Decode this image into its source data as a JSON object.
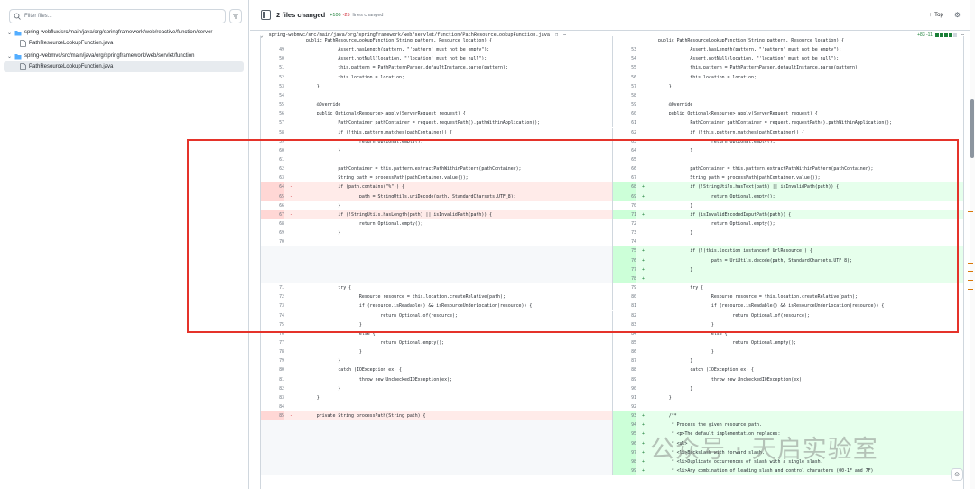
{
  "sidebar": {
    "filter_placeholder": "Filter files...",
    "tree": [
      {
        "type": "folder",
        "label": "spring-webflux/src/main/java/org/springframework/web/reactive/function/server"
      },
      {
        "type": "file",
        "label": "PathResourceLookupFunction.java"
      },
      {
        "type": "folder",
        "label": "spring-webmvc/src/main/java/org/springframework/web/servlet/function"
      },
      {
        "type": "file",
        "label": "PathResourceLookupFunction.java",
        "selected": true
      }
    ]
  },
  "topbar": {
    "files_changed": "2 files changed",
    "additions": "+106",
    "deletions": "-25",
    "files_changed_suffix": "lines changed",
    "top_label": "Top"
  },
  "file_header": {
    "path": "spring-webmvc/src/main/java/org/springframework/web/servlet/function/PathResourceLookupFunction.java",
    "stat": "+83 -11"
  },
  "watermark": "公众号 · 天启实验室",
  "diff_rows": [
    {
      "t": "hunk",
      "l": {
        "n": "",
        "c": "public PathResourceLookupFunction(String pattern, Resource location) {"
      },
      "r": {
        "n": "",
        "c": "public PathResourceLookupFunction(String pattern, Resource location) {"
      }
    },
    {
      "l": {
        "n": "49",
        "c": "            Assert.hasLength(pattern, \"'pattern' must not be empty\");"
      },
      "r": {
        "n": "53",
        "c": "            Assert.hasLength(pattern, \"'pattern' must not be empty\");"
      }
    },
    {
      "l": {
        "n": "50",
        "c": "            Assert.notNull(location, \"'location' must not be null\");"
      },
      "r": {
        "n": "54",
        "c": "            Assert.notNull(location, \"'location' must not be null\");"
      }
    },
    {
      "l": {
        "n": "51",
        "c": "            this.pattern = PathPatternParser.defaultInstance.parse(pattern);"
      },
      "r": {
        "n": "55",
        "c": "            this.pattern = PathPatternParser.defaultInstance.parse(pattern);"
      }
    },
    {
      "l": {
        "n": "52",
        "c": "            this.location = location;"
      },
      "r": {
        "n": "56",
        "c": "            this.location = location;"
      }
    },
    {
      "l": {
        "n": "53",
        "c": "    }"
      },
      "r": {
        "n": "57",
        "c": "    }"
      }
    },
    {
      "l": {
        "n": "54",
        "c": ""
      },
      "r": {
        "n": "58",
        "c": ""
      }
    },
    {
      "l": {
        "n": "55",
        "c": "    @Override"
      },
      "r": {
        "n": "59",
        "c": "    @Override"
      }
    },
    {
      "l": {
        "n": "56",
        "c": "    public Optional<Resource> apply(ServerRequest request) {"
      },
      "r": {
        "n": "60",
        "c": "    public Optional<Resource> apply(ServerRequest request) {"
      }
    },
    {
      "l": {
        "n": "57",
        "c": "            PathContainer pathContainer = request.requestPath().pathWithinApplication();"
      },
      "r": {
        "n": "61",
        "c": "            PathContainer pathContainer = request.requestPath().pathWithinApplication();"
      }
    },
    {
      "l": {
        "n": "58",
        "c": "            if (!this.pattern.matches(pathContainer)) {"
      },
      "r": {
        "n": "62",
        "c": "            if (!this.pattern.matches(pathContainer)) {"
      }
    },
    {
      "l": {
        "n": "59",
        "c": "                    return Optional.empty();"
      },
      "r": {
        "n": "63",
        "c": "                    return Optional.empty();"
      }
    },
    {
      "l": {
        "n": "60",
        "c": "            }"
      },
      "r": {
        "n": "64",
        "c": "            }"
      }
    },
    {
      "l": {
        "n": "61",
        "c": ""
      },
      "r": {
        "n": "65",
        "c": ""
      }
    },
    {
      "l": {
        "n": "62",
        "c": "            pathContainer = this.pattern.extractPathWithinPattern(pathContainer);"
      },
      "r": {
        "n": "66",
        "c": "            pathContainer = this.pattern.extractPathWithinPattern(pathContainer);"
      }
    },
    {
      "l": {
        "n": "63",
        "c": "            String path = processPath(pathContainer.value());"
      },
      "r": {
        "n": "67",
        "c": "            String path = processPath(pathContainer.value());"
      }
    },
    {
      "t": "change",
      "l": {
        "n": "64",
        "m": "-",
        "c": "            if (path.contains(\"%\")) {"
      },
      "r": {
        "n": "68",
        "m": "+",
        "c": "            if (!StringUtils.hasText(path) || isInvalidPath(path)) {"
      }
    },
    {
      "t": "change",
      "l": {
        "n": "65",
        "m": "-",
        "c": "                    path = StringUtils.uriDecode(path, StandardCharsets.UTF_8);"
      },
      "r": {
        "n": "69",
        "m": "+",
        "c": "                    return Optional.empty();"
      }
    },
    {
      "l": {
        "n": "66",
        "c": "            }"
      },
      "r": {
        "n": "70",
        "c": "            }"
      }
    },
    {
      "t": "change",
      "l": {
        "n": "67",
        "m": "-",
        "c": "            if (!StringUtils.hasLength(path) || isInvalidPath(path)) {"
      },
      "r": {
        "n": "71",
        "m": "+",
        "c": "            if (isInvalidEncodedInputPath(path)) {"
      }
    },
    {
      "l": {
        "n": "68",
        "c": "                    return Optional.empty();"
      },
      "r": {
        "n": "72",
        "c": "                    return Optional.empty();"
      }
    },
    {
      "l": {
        "n": "69",
        "c": "            }"
      },
      "r": {
        "n": "73",
        "c": "            }"
      }
    },
    {
      "l": {
        "n": "70",
        "c": ""
      },
      "r": {
        "n": "74",
        "c": ""
      }
    },
    {
      "t": "addonly",
      "l": {
        "n": "",
        "c": ""
      },
      "r": {
        "n": "75",
        "m": "+",
        "c": "            if (!(this.location instanceof UrlResource)) {"
      }
    },
    {
      "t": "addonly",
      "l": {
        "n": "",
        "c": ""
      },
      "r": {
        "n": "76",
        "m": "+",
        "c": "                    path = UriUtils.decode(path, StandardCharsets.UTF_8);"
      }
    },
    {
      "t": "addonly",
      "l": {
        "n": "",
        "c": ""
      },
      "r": {
        "n": "77",
        "m": "+",
        "c": "            }"
      }
    },
    {
      "t": "addonly",
      "l": {
        "n": "",
        "c": ""
      },
      "r": {
        "n": "78",
        "m": "+",
        "c": ""
      }
    },
    {
      "l": {
        "n": "71",
        "c": "            try {"
      },
      "r": {
        "n": "79",
        "c": "            try {"
      }
    },
    {
      "l": {
        "n": "72",
        "c": "                    Resource resource = this.location.createRelative(path);"
      },
      "r": {
        "n": "80",
        "c": "                    Resource resource = this.location.createRelative(path);"
      }
    },
    {
      "l": {
        "n": "73",
        "c": "                    if (resource.isReadable() && isResourceUnderLocation(resource)) {"
      },
      "r": {
        "n": "81",
        "c": "                    if (resource.isReadable() && isResourceUnderLocation(resource)) {"
      }
    },
    {
      "l": {
        "n": "74",
        "c": "                            return Optional.of(resource);"
      },
      "r": {
        "n": "82",
        "c": "                            return Optional.of(resource);"
      }
    },
    {
      "l": {
        "n": "75",
        "c": "                    }"
      },
      "r": {
        "n": "83",
        "c": "                    }"
      }
    },
    {
      "l": {
        "n": "76",
        "c": "                    else {"
      },
      "r": {
        "n": "84",
        "c": "                    else {"
      }
    },
    {
      "l": {
        "n": "77",
        "c": "                            return Optional.empty();"
      },
      "r": {
        "n": "85",
        "c": "                            return Optional.empty();"
      }
    },
    {
      "l": {
        "n": "78",
        "c": "                    }"
      },
      "r": {
        "n": "86",
        "c": "                    }"
      }
    },
    {
      "l": {
        "n": "79",
        "c": "            }"
      },
      "r": {
        "n": "87",
        "c": "            }"
      }
    },
    {
      "l": {
        "n": "80",
        "c": "            catch (IOException ex) {"
      },
      "r": {
        "n": "88",
        "c": "            catch (IOException ex) {"
      }
    },
    {
      "l": {
        "n": "81",
        "c": "                    throw new UncheckedIOException(ex);"
      },
      "r": {
        "n": "89",
        "c": "                    throw new UncheckedIOException(ex);"
      }
    },
    {
      "l": {
        "n": "82",
        "c": "            }"
      },
      "r": {
        "n": "90",
        "c": "            }"
      }
    },
    {
      "l": {
        "n": "83",
        "c": "    }"
      },
      "r": {
        "n": "91",
        "c": "    }"
      }
    },
    {
      "l": {
        "n": "84",
        "c": ""
      },
      "r": {
        "n": "92",
        "c": ""
      }
    },
    {
      "t": "change",
      "l": {
        "n": "85",
        "m": "-",
        "c": "    private String processPath(String path) {"
      },
      "r": {
        "n": "93",
        "m": "+",
        "c": "    /**"
      }
    },
    {
      "t": "addonly",
      "l": {
        "n": "",
        "c": ""
      },
      "r": {
        "n": "94",
        "m": "+",
        "c": "     * Process the given resource path."
      }
    },
    {
      "t": "addonly",
      "l": {
        "n": "",
        "c": ""
      },
      "r": {
        "n": "95",
        "m": "+",
        "c": "     * <p>The default implementation replaces:"
      }
    },
    {
      "t": "addonly",
      "l": {
        "n": "",
        "c": ""
      },
      "r": {
        "n": "96",
        "m": "+",
        "c": "     * <ul>"
      }
    },
    {
      "t": "addonly",
      "l": {
        "n": "",
        "c": ""
      },
      "r": {
        "n": "97",
        "m": "+",
        "c": "     * <li>Backslash with forward slash."
      }
    },
    {
      "t": "addonly",
      "l": {
        "n": "",
        "c": ""
      },
      "r": {
        "n": "98",
        "m": "+",
        "c": "     * <li>Duplicate occurrences of slash with a single slash."
      }
    },
    {
      "t": "addonly",
      "l": {
        "n": "",
        "c": ""
      },
      "r": {
        "n": "99",
        "m": "+",
        "c": "     * <li>Any combination of leading slash and control characters (00-1F and 7F)"
      }
    }
  ]
}
